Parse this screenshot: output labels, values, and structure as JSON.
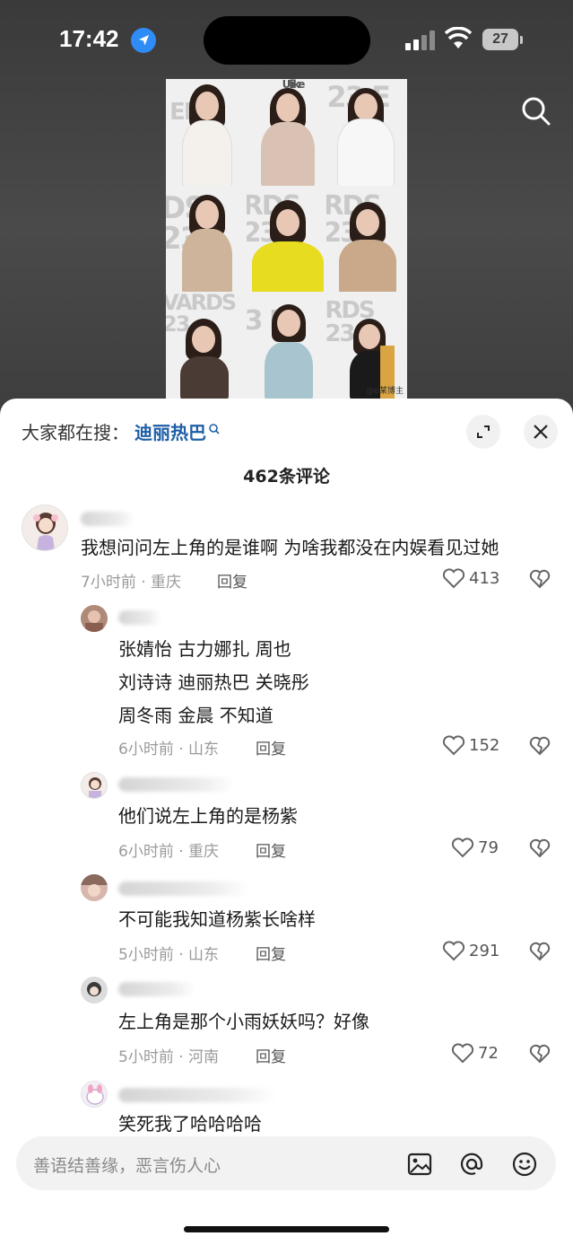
{
  "status": {
    "time": "17:42",
    "battery": "27"
  },
  "collage": {
    "watermark": "@e某博主",
    "tiles": [
      {
        "text": "ELLE",
        "body": "#f4f1ec"
      },
      {
        "text": "Ulike",
        "body": "#d9c2b3"
      },
      {
        "text": "23 E",
        "body": "#f7f7f7"
      },
      {
        "text": "DS 23",
        "body": "#cdb49a"
      },
      {
        "text": "RDS 23",
        "body": "#e7dc1f"
      },
      {
        "text": "RDS 23",
        "body": "#c9a98a"
      },
      {
        "text": "VARDS 23",
        "body": "#4a3c35"
      },
      {
        "text": "3 EL",
        "body": "#a8c4ce"
      },
      {
        "text": "RDS 23",
        "body": "#1a1a1a"
      }
    ]
  },
  "sheet": {
    "hot_label": "大家都在搜：",
    "hot_keyword": "迪丽热巴",
    "comment_count": "462条评论"
  },
  "comments": [
    {
      "text": "我想问问左上角的是谁啊 为啥我都没在内娱看见过她",
      "time": "7小时前 · 重庆",
      "reply": "回复",
      "likes": "413"
    },
    {
      "lines": [
        "张婧怡 古力娜扎 周也",
        "刘诗诗 迪丽热巴 关晓彤",
        "周冬雨 金晨 不知道"
      ],
      "time": "6小时前 · 山东",
      "reply": "回复",
      "likes": "152"
    },
    {
      "text": "他们说左上角的是杨紫",
      "time": "6小时前 · 重庆",
      "reply": "回复",
      "likes": "79"
    },
    {
      "text": "不可能我知道杨紫长啥样",
      "time": "5小时前 · 山东",
      "reply": "回复",
      "likes": "291"
    },
    {
      "text": "左上角是那个小雨妖妖吗？好像",
      "time": "5小时前 · 河南",
      "reply": "回复",
      "likes": "72"
    },
    {
      "text": "笑死我了哈哈哈哈"
    }
  ],
  "input": {
    "placeholder": "善语结善缘，恶言伤人心"
  }
}
